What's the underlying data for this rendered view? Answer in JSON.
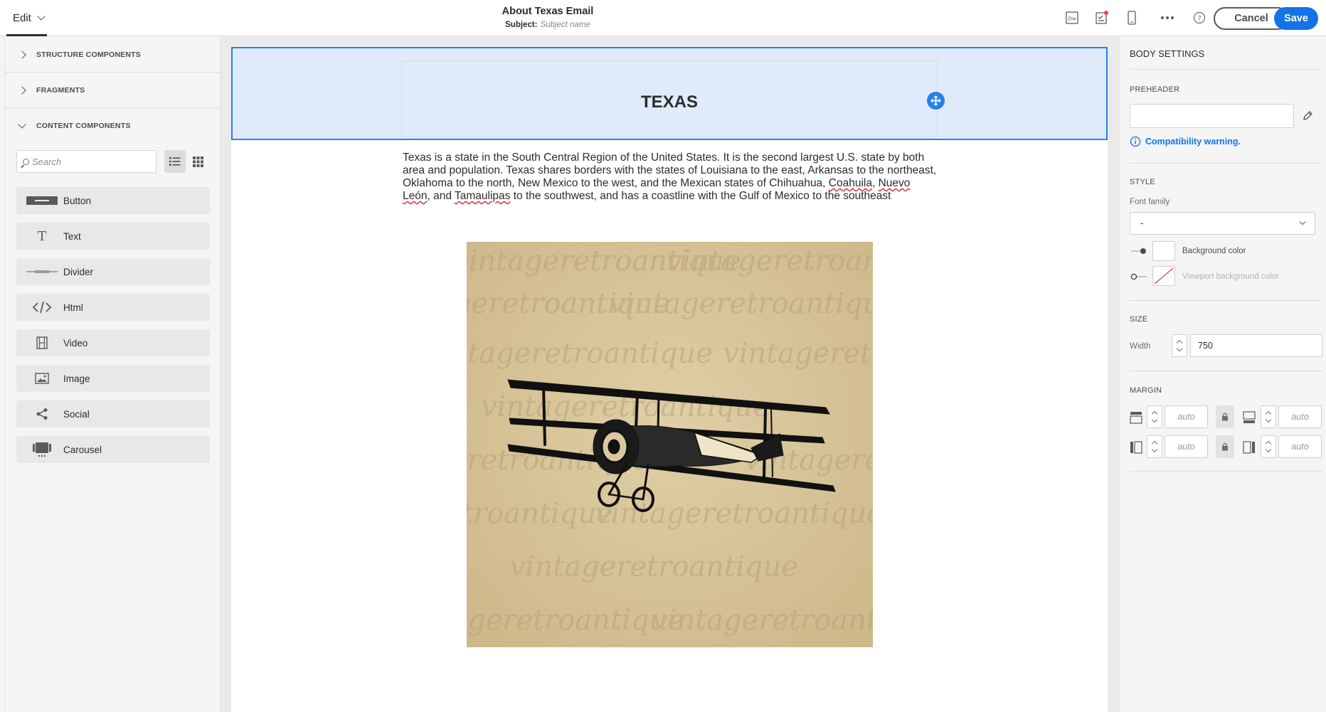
{
  "topbar": {
    "edit_label": "Edit",
    "title": "About Texas Email",
    "subject_label": "Subject:",
    "subject_placeholder": "Subject name",
    "cancel_label": "Cancel",
    "save_label": "Save",
    "icons": [
      "dreamweaver-icon",
      "checklist-icon",
      "mobile-preview-icon",
      "more-icon",
      "help-icon"
    ],
    "notification_dot_color": "#e34850"
  },
  "left": {
    "sections": [
      {
        "label": "STRUCTURE COMPONENTS",
        "expanded": false
      },
      {
        "label": "FRAGMENTS",
        "expanded": false
      },
      {
        "label": "CONTENT COMPONENTS",
        "expanded": true
      }
    ],
    "search_placeholder": "Search",
    "components": [
      {
        "label": "Button",
        "icon": "button-icon"
      },
      {
        "label": "Text",
        "icon": "text-icon"
      },
      {
        "label": "Divider",
        "icon": "divider-icon"
      },
      {
        "label": "Html",
        "icon": "html-icon"
      },
      {
        "label": "Video",
        "icon": "video-icon"
      },
      {
        "label": "Image",
        "icon": "image-icon"
      },
      {
        "label": "Social",
        "icon": "social-icon"
      },
      {
        "label": "Carousel",
        "icon": "carousel-icon"
      }
    ]
  },
  "canvas": {
    "heading": "TEXAS",
    "paragraph_parts": [
      "Texas is a state in the South Central Region of the United States. It is the second largest U.S. state by both area and population. Texas shares borders with the states of Louisiana to the east, Arkansas to the northeast, Oklahoma to the north, New Mexico to the west, and the Mexican states of Chihuahua, ",
      "Coahuila",
      ", ",
      "Nuevo León",
      ", and ",
      "Tamaulipas",
      " to the southwest, and has a coastline with the Gulf of Mexico to the southeast"
    ],
    "image_watermark": "vintageretroantique",
    "accent_color": "#2680eb"
  },
  "right": {
    "body_settings": "BODY SETTINGS",
    "preheader": "PREHEADER",
    "preheader_value": "",
    "compat_warning": "Compatibility warning.",
    "style": "STYLE",
    "font_family_label": "Font family",
    "font_family_value": "-",
    "background_color_label": "Background color",
    "viewport_bg_label": "Viewport background color",
    "size": "SIZE",
    "width_label": "Width",
    "width_value": "750",
    "margin": "MARGIN",
    "margin_top": "auto",
    "margin_bottom": "auto",
    "margin_left": "auto",
    "margin_right": "auto"
  }
}
